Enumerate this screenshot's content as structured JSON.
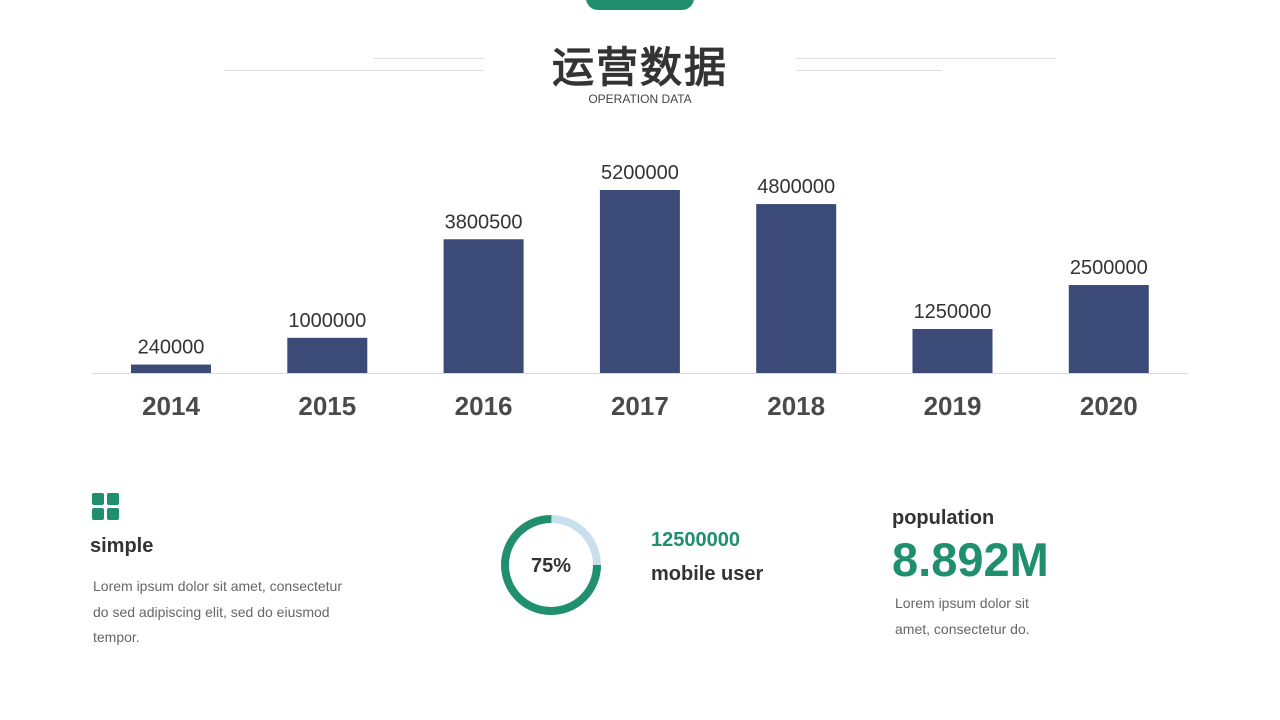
{
  "header": {
    "title": "运营数据",
    "subtitle": "OPERATION DATA"
  },
  "colors": {
    "bar": "#3c4a78",
    "accent": "#1f8f6e",
    "ring_track": "#c9dfec",
    "text": "#333333"
  },
  "chart_data": {
    "type": "bar",
    "categories": [
      "2014",
      "2015",
      "2016",
      "2017",
      "2018",
      "2019",
      "2020"
    ],
    "values": [
      240000,
      1000000,
      3800500,
      5200000,
      4800000,
      1250000,
      2500000
    ],
    "data_labels": [
      "240000",
      "1000000",
      "3800500",
      "5200000",
      "4800000",
      "1250000",
      "2500000"
    ],
    "ylim": [
      0,
      5200000
    ],
    "grid": false,
    "legend": "none"
  },
  "features": {
    "simple": {
      "icon": "grid-icon",
      "title": "simple",
      "desc": "Lorem ipsum dolor sit amet, consectetur  do sed adipiscing elit, sed do eiusmod tempor."
    },
    "mobile": {
      "percent_label": "75%",
      "percent": 0.75,
      "count": "12500000",
      "label": "mobile user"
    },
    "population": {
      "title": "population",
      "value": "8.892M",
      "desc": "Lorem ipsum dolor sit amet, consectetur do."
    }
  }
}
